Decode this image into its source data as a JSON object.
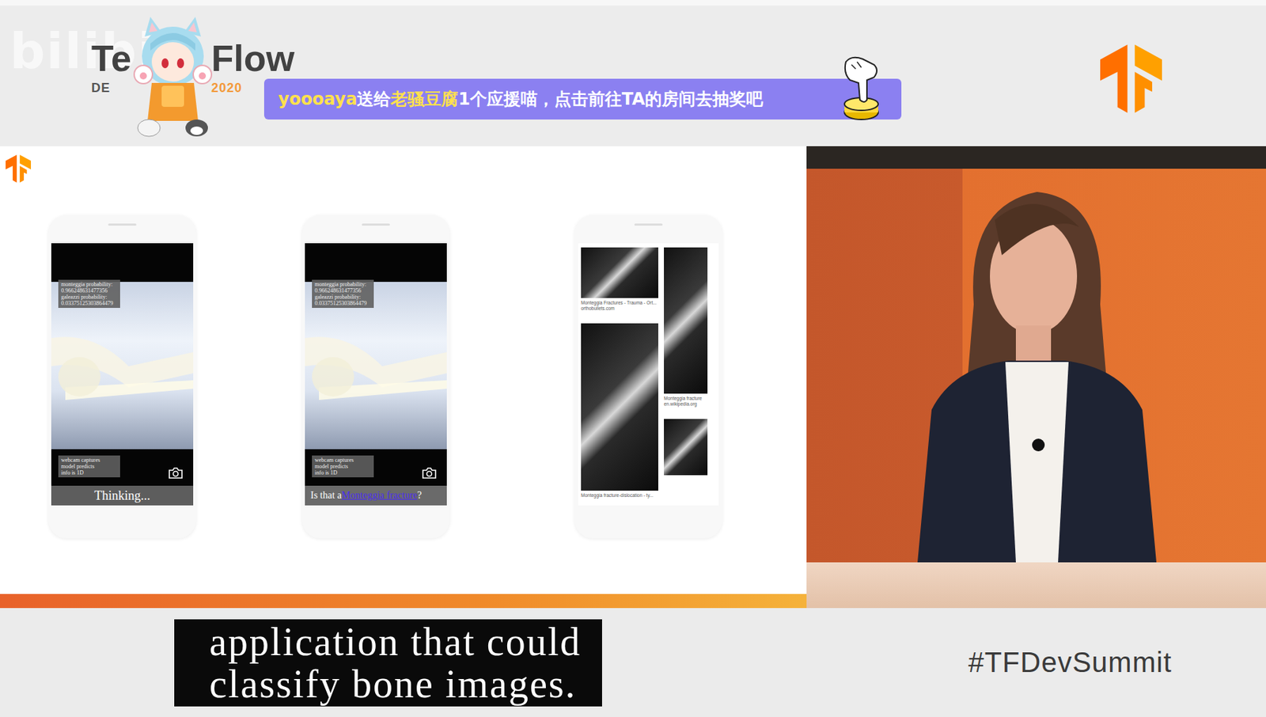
{
  "watermark": "bilibili",
  "header": {
    "title_parts": [
      "Te",
      "Flow"
    ],
    "subtitle_parts": [
      "DE",
      "2020"
    ]
  },
  "notification": {
    "sender": "yoooaya",
    "verb": "送给",
    "receiver": "老骚豆腐",
    "message": "1个应援喵，点击前往TA的房间去抽奖吧"
  },
  "phones": [
    {
      "kind": "app",
      "probabilities": [
        "monteggia probability:",
        "0.966248631477356",
        "galeazzi probability:",
        "0.03375125303864479"
      ],
      "info": [
        "webcam captures",
        "model predicts",
        "info is 1D"
      ],
      "status": {
        "text": "Thinking..."
      }
    },
    {
      "kind": "app",
      "probabilities": [
        "monteggia probability:",
        "0.966248631477356",
        "galeazzi probability:",
        "0.03375125303864479"
      ],
      "info": [
        "webcam captures",
        "model predicts",
        "info is 1D"
      ],
      "status": {
        "text": "Is that a ",
        "link": "Monteggia fracture",
        "suffix": "?"
      }
    },
    {
      "kind": "results",
      "columns": [
        [
          {
            "caption": "Monteggia Fractures - Trauma - Ort...",
            "source": "orthobullets.com"
          },
          {
            "caption": "Monteggia fracture-dislocation - ty..."
          }
        ],
        [
          {
            "caption": "Monteggia fracture",
            "source": "en.wikipedia.org"
          },
          {}
        ]
      ]
    }
  ],
  "caption": [
    "application that could",
    "classify bone images."
  ],
  "hashtag": "#TFDevSummit"
}
